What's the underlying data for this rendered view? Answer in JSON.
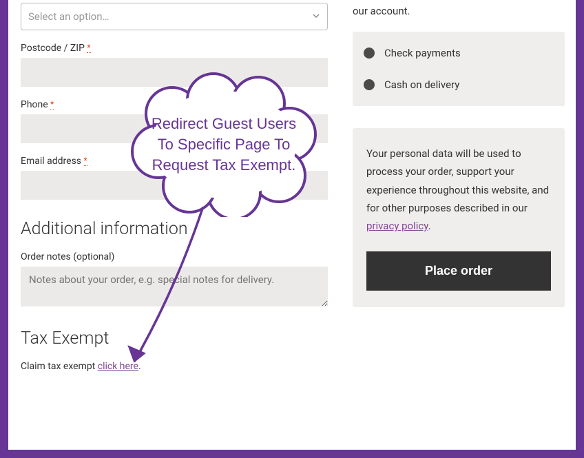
{
  "form": {
    "state_placeholder": "Select an option…",
    "postcode_label": "Postcode / ZIP",
    "postcode_value": "",
    "phone_label": "Phone",
    "phone_value": "",
    "email_label": "Email address",
    "email_value": "",
    "required_mark": "*"
  },
  "additional": {
    "heading": "Additional information",
    "order_notes_label": "Order notes (optional)",
    "order_notes_placeholder": "Notes about your order, e.g. special notes for delivery."
  },
  "tax_exempt": {
    "heading": "Tax Exempt",
    "text_prefix": "Claim tax exempt ",
    "link_text": "click here",
    "text_suffix": "."
  },
  "right": {
    "top_text": "our account.",
    "payment_options": {
      "check": "Check payments",
      "cash": "Cash on delivery"
    },
    "privacy_text": "Your personal data will be used to process your order, support your experience throughout this website, and for other purposes described in our ",
    "privacy_link": "privacy policy",
    "privacy_suffix": ".",
    "place_order": "Place order"
  },
  "callout": {
    "text": "Redirect Guest Users To Specific Page To Request Tax Exempt."
  }
}
